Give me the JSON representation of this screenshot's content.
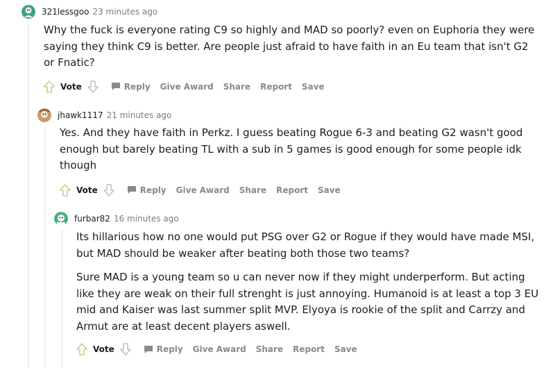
{
  "comments": [
    {
      "username": "321lessgoo",
      "time": "23 minutes ago",
      "avatar_color": "#3aa37a",
      "paragraphs": [
        "Why the fuck is everyone rating C9 so highly and MAD so poorly? even on Euphoria they were saying they think C9 is better. Are people just afraid to have faith in an Eu team that isn't G2 or Fnatic?"
      ]
    },
    {
      "username": "jhawk1117",
      "time": "21 minutes ago",
      "avatar_color": "#c99a6b",
      "paragraphs": [
        "Yes. And they have faith in Perkz. I guess beating Rogue 6-3 and beating G2 wasn't good enough but barely beating TL with a sub in 5 games is good enough for some people idk though"
      ]
    },
    {
      "username": "furbar82",
      "time": "16 minutes ago",
      "avatar_color": "#46b07c",
      "paragraphs": [
        "Its hillarious how no one would put PSG over G2 or Rogue if they would have made MSI, but MAD should be weaker after beating both those two teams?",
        "Sure MAD is a young team so u can never now if they might underperform. But acting like they are weak on their full strenght is just annoying. Humanoid is at least a top 3 EU mid and Kaiser was last summer split MVP. Elyoya is rookie of the split and Carrzy and Armut are at least decent players aswell."
      ]
    }
  ],
  "actions": {
    "vote": "Vote",
    "reply": "Reply",
    "give_award": "Give Award",
    "share": "Share",
    "report": "Report",
    "save": "Save"
  },
  "colors": {
    "upvote": "#b5d98a",
    "downvote": "#b9c3cc",
    "action_text": "#878a8c",
    "thread_line": "#edeff1"
  },
  "icons": [
    "upvote-arrow-icon",
    "downvote-arrow-icon",
    "reply-icon",
    "avatar-icon"
  ]
}
